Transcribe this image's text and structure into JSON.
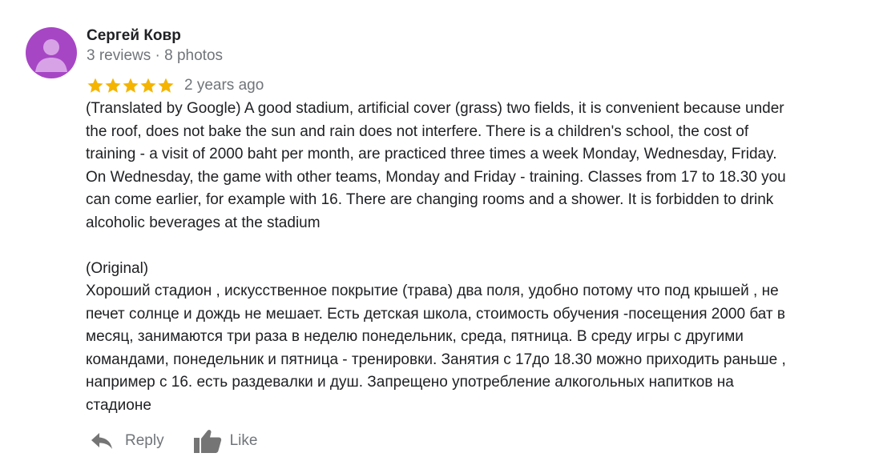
{
  "review": {
    "author": {
      "name": "Сергей Ковр",
      "meta": "3 reviews · 8 photos",
      "avatar_color": "#a746c5",
      "avatar_icon": "person-silhouette-icon"
    },
    "rating": {
      "stars": 5,
      "max": 5,
      "star_color": "#f4b400"
    },
    "date": "2 years ago",
    "text": "(Translated by Google) A good stadium, artificial cover (grass) two fields, it is convenient because under\nthe roof, does not bake the sun and rain does not interfere. There is a children's school, the cost of\ntraining - a visit of 2000 baht per month, are practiced three times a week Monday, Wednesday, Friday.\nOn Wednesday, the game with other teams, Monday and Friday - training. Classes from 17 to 18.30 you\ncan come earlier, for example with 16. There are changing rooms and a shower. It is forbidden to drink\nalcoholic beverages at the stadium\n\n(Original)\nХороший стадион , искусственное покрытие (трава) два поля, удобно потому что под крышей , не\nпечет солнце и дождь не мешает. Есть детская школа, стоимость обучения -посещения 2000 бат в\nмесяц, занимаются три раза в неделю понедельник, среда, пятница. В среду игры с другими\nкомандами, понедельник и пятница - тренировки. Занятия с 17до 18.30 можно приходить раньше ,\nнапример с 16. есть раздевалки и душ. Запрещено употребление алкогольных напитков на\nстадионе",
    "actions": {
      "reply_label": "Reply",
      "reply_icon": "reply-arrow-icon",
      "like_label": "Like",
      "like_icon": "thumbs-up-icon",
      "icon_color": "#757575"
    }
  }
}
